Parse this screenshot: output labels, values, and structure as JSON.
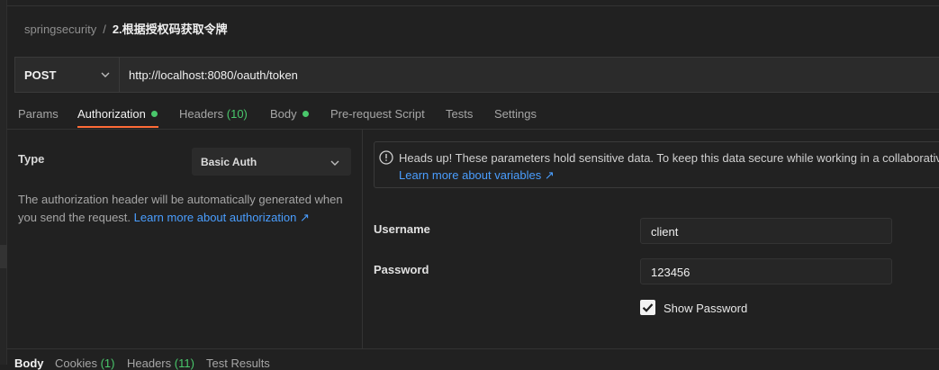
{
  "breadcrumb": {
    "parent": "springsecurity",
    "separator": "/",
    "current": "2.根据授权码获取令牌"
  },
  "request": {
    "method": "POST",
    "url": "http://localhost:8080/oauth/token"
  },
  "tabs": [
    {
      "label": "Params"
    },
    {
      "label": "Authorization",
      "active": true,
      "indicator": "dot"
    },
    {
      "label": "Headers",
      "count": "(10)"
    },
    {
      "label": "Body",
      "indicator": "dot"
    },
    {
      "label": "Pre-request Script"
    },
    {
      "label": "Tests"
    },
    {
      "label": "Settings"
    }
  ],
  "auth": {
    "type_label": "Type",
    "type_value": "Basic Auth",
    "description": "The authorization header will be automatically generated when you send the request.",
    "learn_link": "Learn more about authorization ↗"
  },
  "notice": {
    "text": "Heads up! These parameters hold sensitive data. To keep this data secure while working in a collaborative",
    "link": "Learn more about variables ↗"
  },
  "fields": {
    "username_label": "Username",
    "username_value": "client",
    "password_label": "Password",
    "password_value": "123456",
    "show_password_label": "Show Password",
    "show_password_checked": true
  },
  "response_tabs": [
    {
      "label": "Body",
      "active": true
    },
    {
      "label": "Cookies",
      "count": "(1)"
    },
    {
      "label": "Headers",
      "count": "(11)"
    },
    {
      "label": "Test Results"
    }
  ],
  "colors": {
    "background": "#212121",
    "accent": "#ff6c37",
    "indicator_green": "#49c76b",
    "link_blue": "#4a9eff"
  }
}
